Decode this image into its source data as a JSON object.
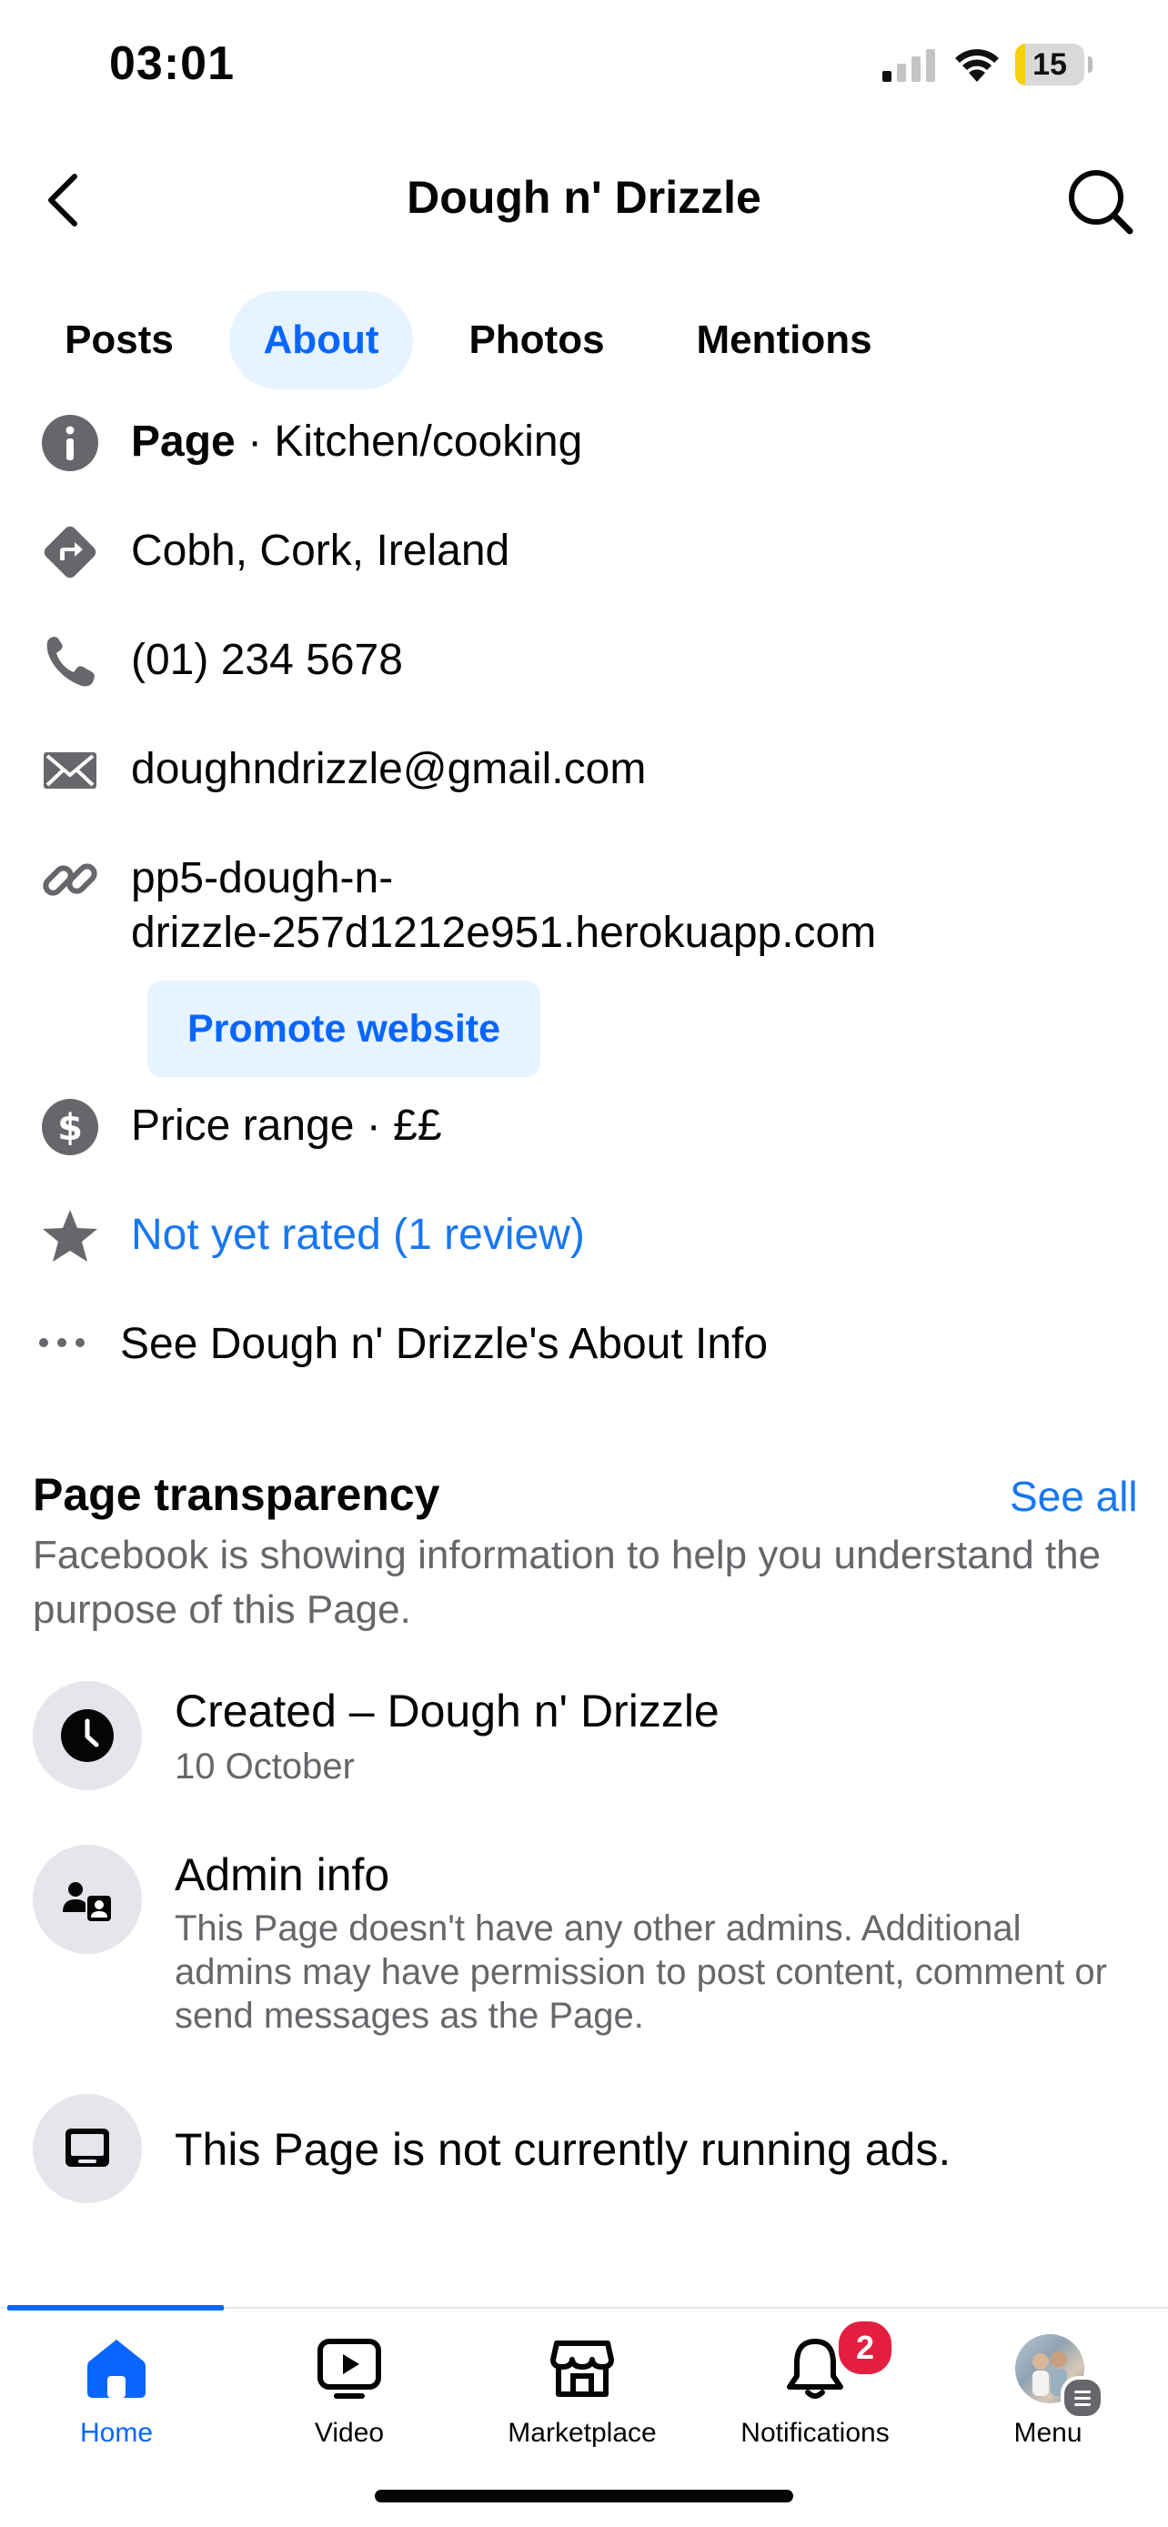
{
  "status_bar": {
    "time": "03:01",
    "battery": "15",
    "battery_level": 0.15
  },
  "header": {
    "title": "Dough n' Drizzle"
  },
  "tabs": [
    {
      "label": "Posts"
    },
    {
      "label": "About",
      "active": true
    },
    {
      "label": "Photos"
    },
    {
      "label": "Mentions"
    }
  ],
  "info": {
    "category_bold": "Page",
    "category_rest": " · Kitchen/cooking",
    "location": "Cobh, Cork, Ireland",
    "phone": "(01) 234 5678",
    "email": "doughndrizzle@gmail.com",
    "website_line1": "pp5-dough-n-",
    "website_line2": "drizzle-257d1212e951.herokuapp.com",
    "promote_label": "Promote website",
    "price_range": "Price range · ££",
    "rating": "Not yet rated (1 review)",
    "see_about": "See Dough n' Drizzle's About Info"
  },
  "transparency": {
    "title": "Page transparency",
    "see_all": "See all",
    "description": "Facebook is showing information to help you understand the purpose of this Page.",
    "items": [
      {
        "title": "Created – Dough n' Drizzle",
        "subtitle": "10 October",
        "icon": "clock-icon"
      },
      {
        "title": "Admin info",
        "subtitle": "This Page doesn't have any other admins. Additional admins may have permission to post content, comment or send messages as the Page.",
        "icon": "admin-icon"
      },
      {
        "title": "This Page is not currently running ads.",
        "icon": "ads-icon"
      }
    ]
  },
  "nav": [
    {
      "label": "Home",
      "icon": "home-icon",
      "active": true
    },
    {
      "label": "Video",
      "icon": "video-icon"
    },
    {
      "label": "Marketplace",
      "icon": "marketplace-icon"
    },
    {
      "label": "Notifications",
      "icon": "bell-icon",
      "badge": "2"
    },
    {
      "label": "Menu",
      "icon": "avatar"
    }
  ],
  "colors": {
    "accent": "#0866ff",
    "link": "#1877f2",
    "secondary_text": "#65676b",
    "badge": "#e41e3f"
  }
}
